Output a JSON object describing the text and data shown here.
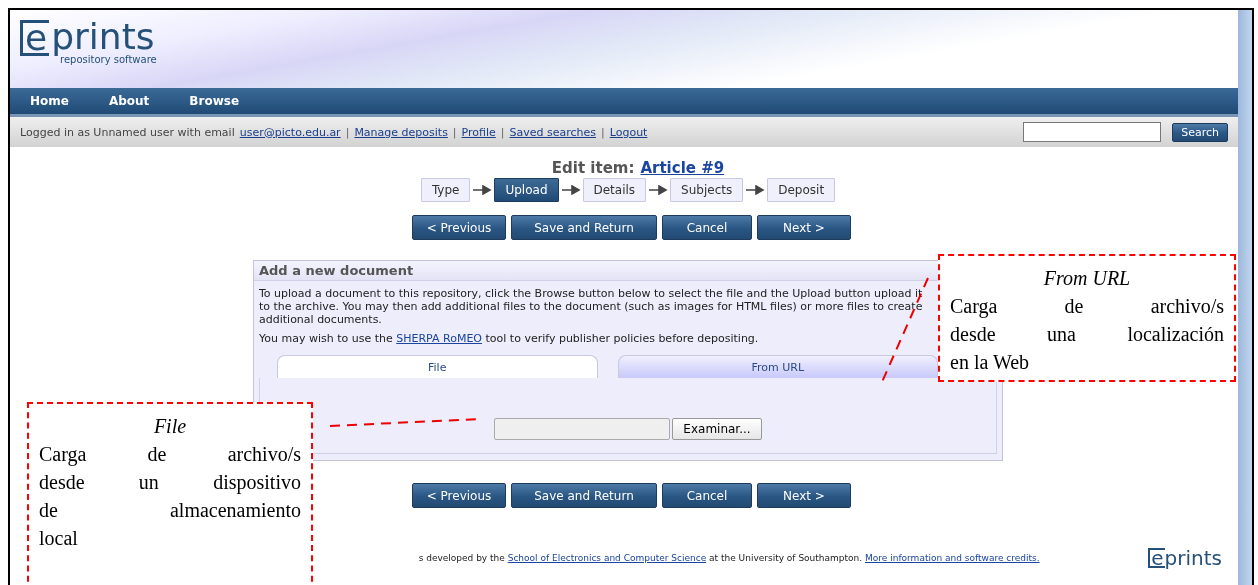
{
  "logo": {
    "mark": "e",
    "word": "prints",
    "tagline": "repository software"
  },
  "nav": [
    {
      "label": "Home"
    },
    {
      "label": "About"
    },
    {
      "label": "Browse"
    }
  ],
  "login_bar": {
    "items": [
      {
        "kind": "text",
        "text": "Logged in as Unnamed user with email"
      },
      {
        "kind": "link",
        "text": "user@picto.edu.ar"
      },
      {
        "kind": "sep",
        "text": "|"
      },
      {
        "kind": "link",
        "text": "Manage deposits"
      },
      {
        "kind": "sep",
        "text": "|"
      },
      {
        "kind": "link",
        "text": "Profile"
      },
      {
        "kind": "sep",
        "text": "|"
      },
      {
        "kind": "link",
        "text": "Saved searches"
      },
      {
        "kind": "sep",
        "text": "|"
      },
      {
        "kind": "link",
        "text": "Logout"
      }
    ],
    "search_button": "Search"
  },
  "page_title": {
    "prefix": "Edit item:",
    "link": "Article #9"
  },
  "steps": [
    {
      "label": "Type",
      "selected": false
    },
    {
      "label": "Upload",
      "selected": true
    },
    {
      "label": "Details",
      "selected": false
    },
    {
      "label": "Subjects",
      "selected": false
    },
    {
      "label": "Deposit",
      "selected": false
    }
  ],
  "buttons_top": [
    "< Previous",
    "Save and Return",
    "Cancel",
    "Next >"
  ],
  "panel": {
    "title": "Add a new document",
    "intro": "To upload a document to this repository, click the Browse button below to select the file and the Upload button upload it to the archive. You may then add additional files to the document (such as images for HTML files) or more files to create additional documents.",
    "note_before": "You may wish to use the",
    "note_link": "SHERPA RoMEO",
    "note_after": "tool to verify publisher policies before depositing.",
    "tabs": [
      {
        "label": "File",
        "selected": true
      },
      {
        "label": "From URL",
        "selected": false
      }
    ],
    "file_button": "Examinar..."
  },
  "buttons_bottom": [
    "< Previous",
    "Save and Return",
    "Cancel",
    "Next >"
  ],
  "footer": {
    "parts": [
      {
        "kind": "text",
        "text": "s developed by the"
      },
      {
        "kind": "link",
        "text": "School of Electronics and Computer Science"
      },
      {
        "kind": "text",
        "text": "at the University of Southampton."
      },
      {
        "kind": "link",
        "text": "More information and software credits."
      }
    ],
    "logo": {
      "mark": "e",
      "word": "prints"
    }
  },
  "annotations": [
    {
      "title": "From URL",
      "lines": [
        "Carga de archivo/s",
        "desde una localización",
        "en la Web"
      ]
    },
    {
      "title": "File",
      "lines": [
        "Carga de archivo/s",
        "desde un dispositivo",
        "de almacenamiento",
        "local"
      ]
    }
  ]
}
